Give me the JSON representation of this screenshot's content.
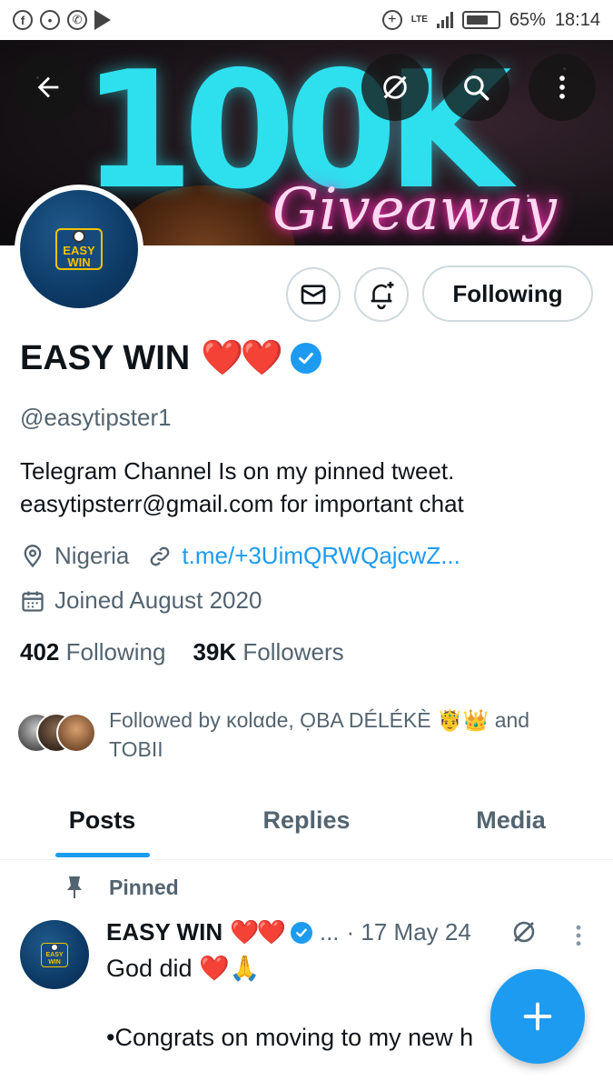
{
  "status_bar": {
    "battery": "65%",
    "time": "18:14",
    "network": "LTE"
  },
  "banner": {
    "big_text": "100K",
    "script_text": "Giveaway"
  },
  "profile": {
    "display_name": "EASY WIN",
    "name_emoji": "❤️❤️",
    "handle": "@easytipster1",
    "bio_line1": "Telegram Channel Is on my pinned tweet.",
    "bio_line2": "easytipsterr@gmail.com for important chat",
    "location": "Nigeria",
    "link": "t.me/+3UimQRWQajcwZ...",
    "joined": "Joined August 2020",
    "following_count": "402",
    "following_label": "Following",
    "followers_count": "39K",
    "followers_label": "Followers",
    "followed_by_line1": "Followed by κolαde, ỌBA DÉLÉKÈ 🤴👑 and",
    "followed_by_line2": "TOBII",
    "avatar_logo_line1": "EASY",
    "avatar_logo_line2": "WIN"
  },
  "actions": {
    "following_button": "Following"
  },
  "tabs": [
    {
      "label": "Posts",
      "active": true
    },
    {
      "label": "Replies",
      "active": false
    },
    {
      "label": "Media",
      "active": false
    }
  ],
  "tweet": {
    "pinned_label": "Pinned",
    "name": "EASY WIN",
    "name_emoji": "❤️❤️",
    "ellipsis": "...",
    "date": "· 17 May 24",
    "text": "God did ❤️🙏\n\n•Congrats on moving to my new h"
  },
  "colors": {
    "accent": "#1d9bf0",
    "secondary_text": "#536471",
    "primary_text": "#0f1419"
  },
  "icons": [
    "back-arrow-icon",
    "grok-icon",
    "search-icon",
    "more-vertical-icon",
    "mail-icon",
    "notification-add-icon",
    "verified-badge-icon",
    "location-pin-icon",
    "link-icon",
    "calendar-icon",
    "pin-icon",
    "compose-plus-icon"
  ]
}
